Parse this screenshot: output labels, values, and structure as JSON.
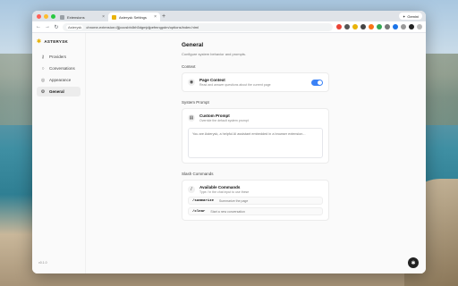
{
  "browser": {
    "tabs": [
      {
        "label": "Extensions"
      },
      {
        "label": "Asterysk Settings"
      }
    ],
    "new_tab_icon": "+",
    "profile_button": "Gemini",
    "address_chip": "Asterysk",
    "url": "chrome-extension://jjjcocsbh4bh5dgmjdjpefmngpdm/options/index.html"
  },
  "sidebar": {
    "brand": "ASTERYSK",
    "items": [
      {
        "label": "Providers",
        "icon": "key-icon"
      },
      {
        "label": "Conversations",
        "icon": "chat-icon"
      },
      {
        "label": "Appearance",
        "icon": "palette-icon"
      },
      {
        "label": "General",
        "icon": "gear-icon"
      }
    ],
    "version": "v0.1.0"
  },
  "main": {
    "title": "General",
    "subtitle": "Configure system behavior and prompts.",
    "context": {
      "section": "Context",
      "title": "Page Context",
      "desc": "Read and answer questions about the current page",
      "enabled": true
    },
    "system_prompt": {
      "section": "System Prompt",
      "title": "Custom Prompt",
      "desc": "Override the default system prompt",
      "placeholder": "You are Asterysk, a helpful AI assistant embedded in a browser extension..."
    },
    "slash": {
      "section": "Slash Commands",
      "title": "Available Commands",
      "desc": "Type / in the chat input to use these",
      "commands": [
        {
          "cmd": "/summarize",
          "desc": "Summarize the page"
        },
        {
          "cmd": "/clear",
          "desc": "Start a new conversation"
        }
      ]
    }
  },
  "colors": {
    "accent": "#3b82f6",
    "brand_star": "#e9b308"
  }
}
